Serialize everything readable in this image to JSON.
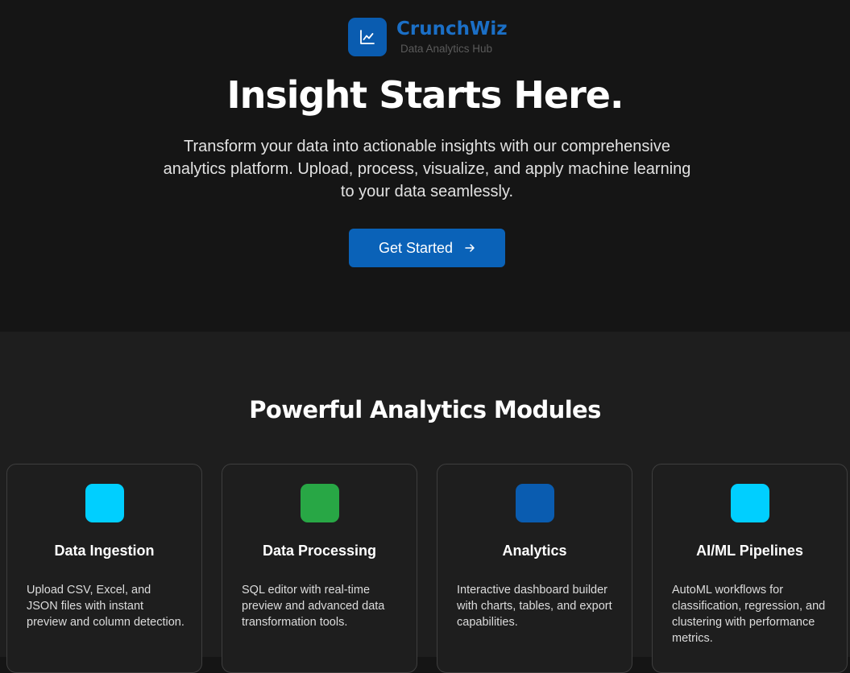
{
  "brand": {
    "name": "CrunchWiz",
    "tagline": "Data Analytics Hub",
    "logo_icon": "line-chart-icon",
    "accent": "#0a5cb0"
  },
  "hero": {
    "title": "Insight Starts Here.",
    "description": "Transform your data into actionable insights with our comprehensive analytics platform. Upload, process, visualize, and apply machine learning to your data seamlessly.",
    "cta_label": "Get Started",
    "cta_icon": "arrow-right-icon",
    "cta_color": "#0a62b8"
  },
  "modules": {
    "title": "Powerful Analytics Modules",
    "cards": [
      {
        "title": "Data Ingestion",
        "description": "Upload CSV, Excel, and JSON files with instant preview and column detection.",
        "icon_color": "#00cfff"
      },
      {
        "title": "Data Processing",
        "description": "SQL editor with real-time preview and advanced data transformation tools.",
        "icon_color": "#28a745"
      },
      {
        "title": "Analytics",
        "description": "Interactive dashboard builder with charts, tables, and export capabilities.",
        "icon_color": "#0a5cb0"
      },
      {
        "title": "AI/ML Pipelines",
        "description": "AutoML workflows for classification, regression, and clustering with performance metrics.",
        "icon_color": "#00cfff"
      }
    ]
  }
}
